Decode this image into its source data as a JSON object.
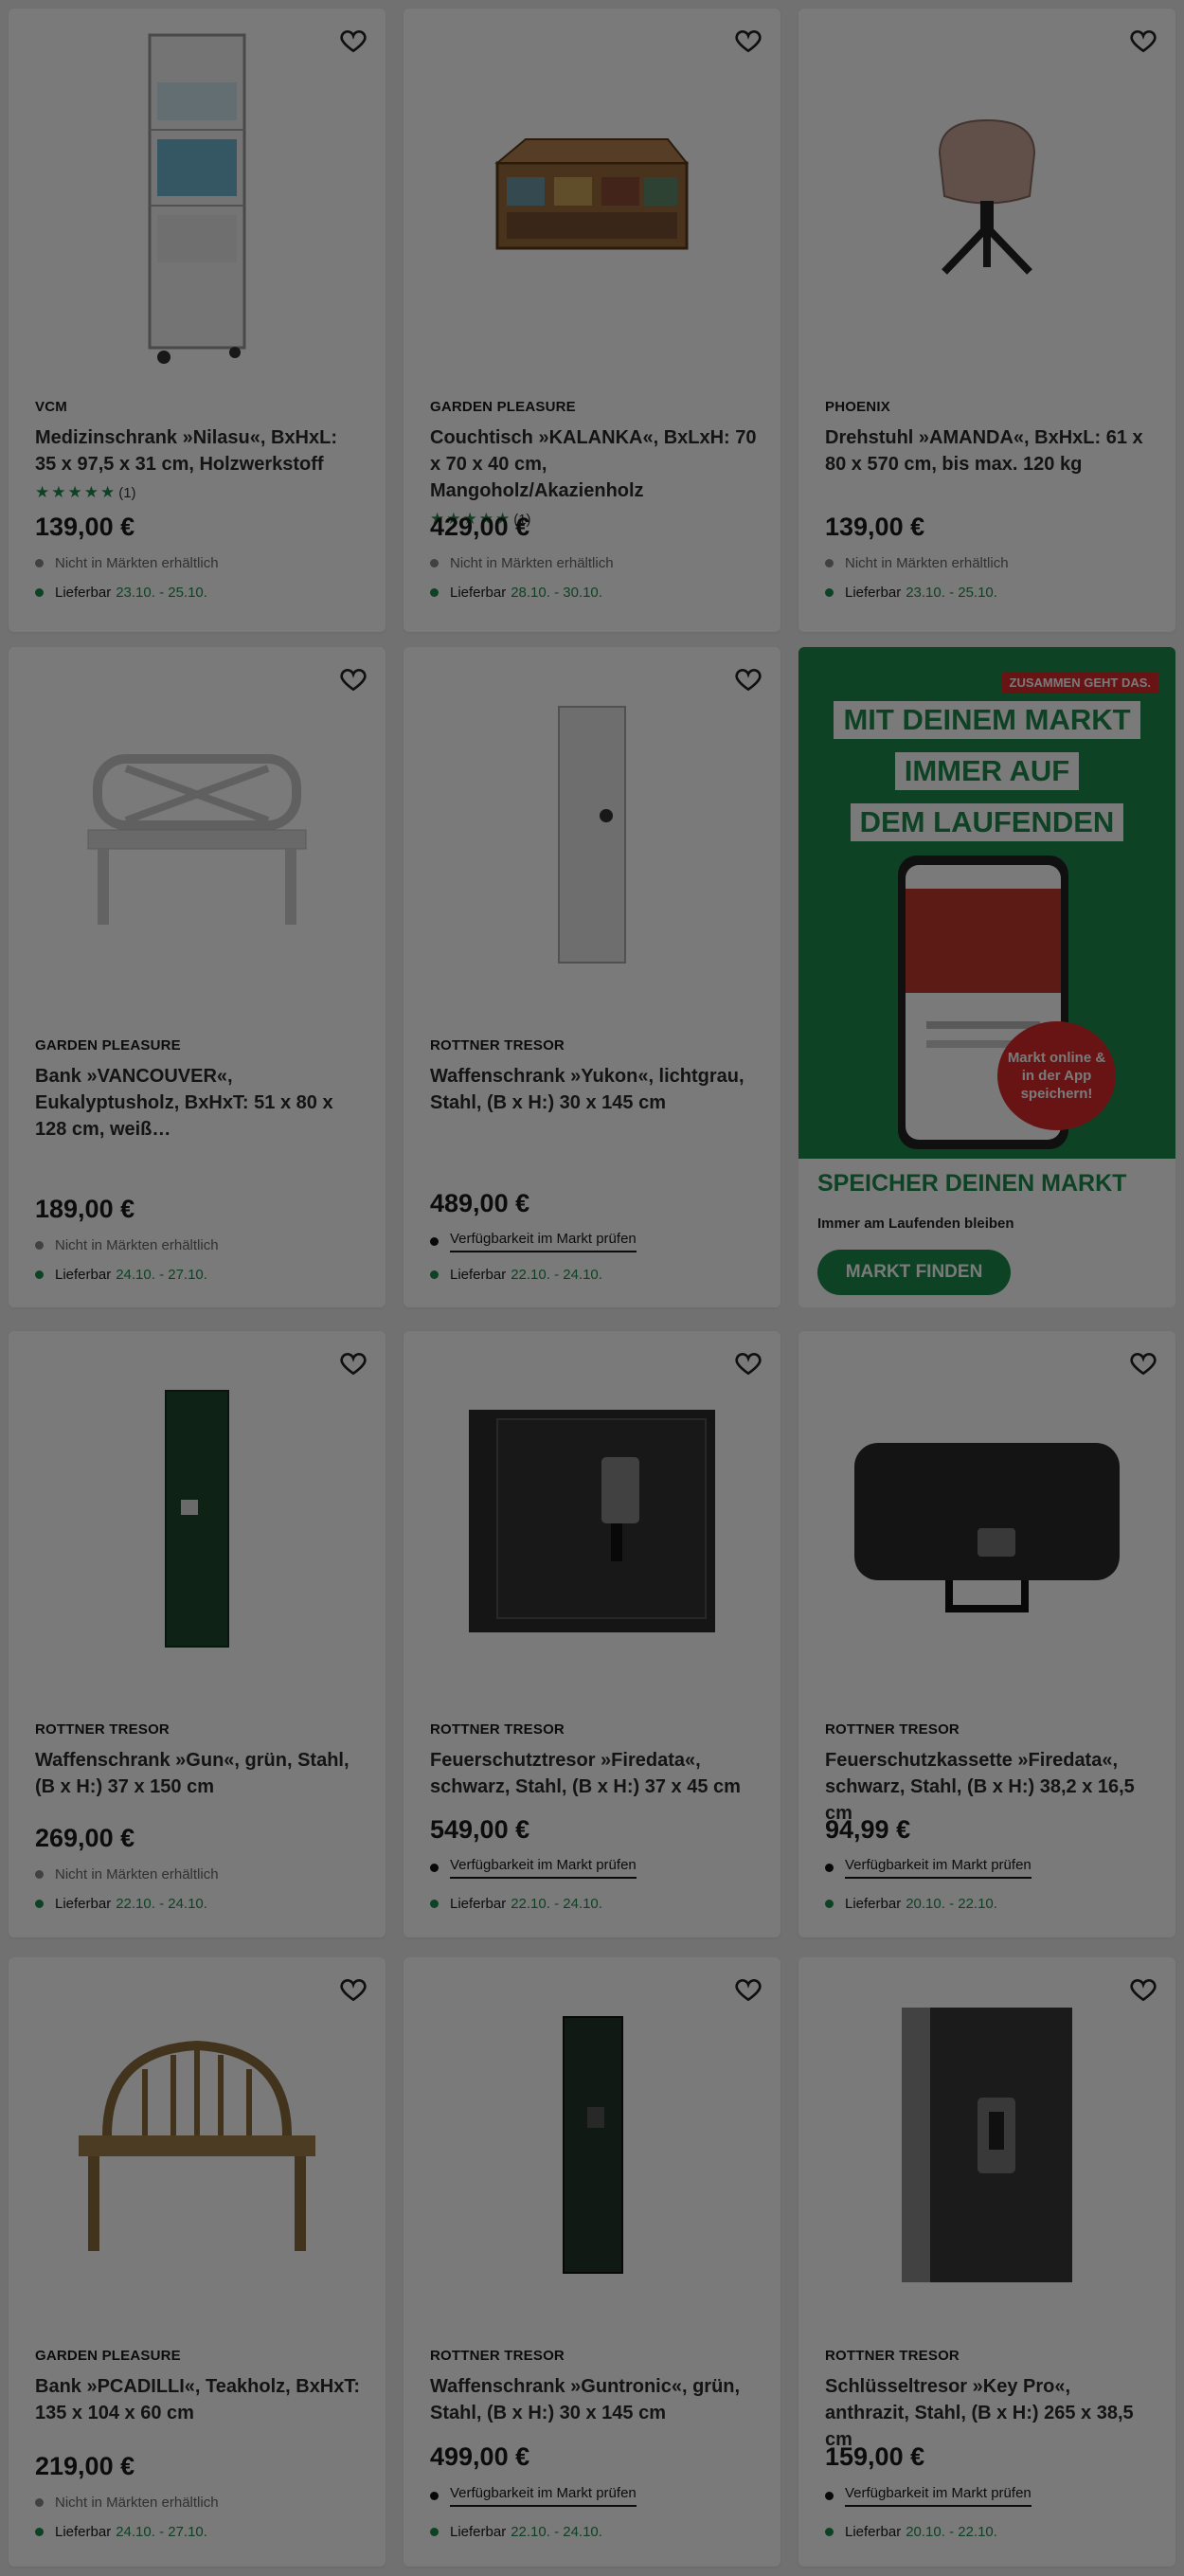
{
  "products": [
    {
      "brand": "VCM",
      "title": "Medizinschrank »Nilasu«, BxHxL: 35 x 97,5 x 31 cm, Holzwerkstoff",
      "rating_count": "(1)",
      "price": "139,00 €",
      "availability": "Nicht in Märkten erhältlich",
      "delivery_label": "Lieferbar",
      "delivery_dates": "23.10. - 25.10.",
      "image": "medicine-cabinet"
    },
    {
      "brand": "GARDEN PLEASURE",
      "title": "Couchtisch »KALANKA«, BxLxH: 70 x 70 x 40 cm, Mangoholz/Akazienholz",
      "rating_count": "(1)",
      "price": "429,00 €",
      "availability": "Nicht in Märkten erhältlich",
      "delivery_label": "Lieferbar",
      "delivery_dates": "28.10. - 30.10.",
      "image": "coffee-table-chest"
    },
    {
      "brand": "PHOENIX",
      "title": "Drehstuhl »AMANDA«, BxHxL: 61 x 80 x 570 cm, bis max. 120 kg",
      "price": "139,00 €",
      "availability": "Nicht in Märkten erhältlich",
      "delivery_label": "Lieferbar",
      "delivery_dates": "23.10. - 25.10.",
      "image": "swivel-chair"
    },
    {
      "brand": "GARDEN PLEASURE",
      "title": "Bank »VANCOUVER«, Eukalyptusholz, BxHxT: 51 x 80 x 128 cm, weiß…",
      "price": "189,00 €",
      "availability": "Nicht in Märkten erhältlich",
      "delivery_label": "Lieferbar",
      "delivery_dates": "24.10. - 27.10.",
      "image": "white-bench"
    },
    {
      "brand": "ROTTNER TRESOR",
      "title": "Waffenschrank »Yukon«, lichtgrau, Stahl, (B x H:) 30 x 145 cm",
      "price": "489,00 €",
      "availability": "Verfügbarkeit im Markt prüfen",
      "delivery_label": "Lieferbar",
      "delivery_dates": "22.10. - 24.10.",
      "image": "grey-gun-cabinet"
    },
    {
      "brand": "ROTTNER TRESOR",
      "title": "Waffenschrank »Gun«, grün, Stahl, (B x H:) 37 x 150 cm",
      "price": "269,00 €",
      "availability": "Nicht in Märkten erhältlich",
      "delivery_label": "Lieferbar",
      "delivery_dates": "22.10. - 24.10.",
      "image": "green-gun-cabinet"
    },
    {
      "brand": "ROTTNER TRESOR",
      "title": "Feuerschutztresor »Firedata«, schwarz, Stahl, (B x H:) 37 x 45 cm",
      "price": "549,00 €",
      "availability": "Verfügbarkeit im Markt prüfen",
      "delivery_label": "Lieferbar",
      "delivery_dates": "22.10. - 24.10.",
      "image": "fire-safe"
    },
    {
      "brand": "ROTTNER TRESOR",
      "title": "Feuerschutzkassette »Firedata«, schwarz, Stahl, (B x H:) 38,2 x 16,5 cm",
      "price": "94,99 €",
      "availability": "Verfügbarkeit im Markt prüfen",
      "delivery_label": "Lieferbar",
      "delivery_dates": "20.10. - 22.10.",
      "image": "fire-box"
    },
    {
      "brand": "GARDEN PLEASURE",
      "title": "Bank »PCADILLI«, Teakholz, BxHxT: 135 x 104 x 60 cm",
      "price": "219,00 €",
      "availability": "Nicht in Märkten erhältlich",
      "delivery_label": "Lieferbar",
      "delivery_dates": "24.10. - 27.10.",
      "image": "teak-bench"
    },
    {
      "brand": "ROTTNER TRESOR",
      "title": "Waffenschrank »Guntronic«, grün, Stahl, (B x H:) 30 x 145 cm",
      "price": "499,00 €",
      "availability": "Verfügbarkeit im Markt prüfen",
      "delivery_label": "Lieferbar",
      "delivery_dates": "22.10. - 24.10.",
      "image": "dark-gun-cabinet"
    },
    {
      "brand": "ROTTNER TRESOR",
      "title": "Schlüsseltresor »Key Pro«, anthrazit, Stahl, (B x H:) 265 x 38,5 cm",
      "price": "159,00 €",
      "availability": "Verfügbarkeit im Markt prüfen",
      "delivery_label": "Lieferbar",
      "delivery_dates": "20.10. - 22.10.",
      "image": "key-safe"
    }
  ],
  "promo": {
    "tag": "ZUSAMMEN GEHT DAS.",
    "headline": [
      "MIT DEINEM MARKT",
      "IMMER AUF",
      "DEM LAUFENDEN"
    ],
    "badge": "Markt online & in der App speichern!",
    "title": "SPEICHER DEINEN MARKT",
    "subtitle": "Immer am Laufenden bleiben",
    "button": "MARKT FINDEN"
  },
  "colors": {
    "accent": "#1f8a4c",
    "tag_red": "#d92b2b",
    "overlay": "rgba(0,0,0,0.52)"
  }
}
